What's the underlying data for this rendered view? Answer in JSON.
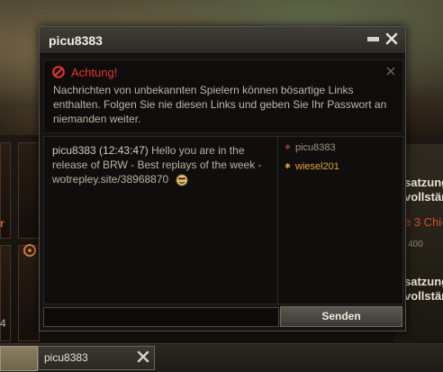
{
  "chat_window": {
    "title": "picu8383",
    "warning": {
      "title": "Achtung!",
      "text": "Nachrichten von unbekannten Spielern können bösartige Links enthalten. Folgen Sie nie diesen Links und geben Sie Ihr Passwort an niemanden weiter."
    },
    "message": {
      "sender": "picu8383 (12:43:47)",
      "text": "Hello you are in the release of BRW - Best replays of the week - wotrepley.site/38968870"
    },
    "participants": [
      {
        "name": "picu8383",
        "status_color": "#8a3a2c"
      },
      {
        "name": "wiesel201",
        "status_color": "#e7a233"
      }
    ],
    "input": {
      "value": ""
    },
    "send_label": "Senden"
  },
  "background": {
    "right_texts": [
      "satzung",
      "vollstän",
      "e 3 Chi-",
      "400",
      "satzung",
      "vollstän"
    ],
    "left_texts": [
      "r",
      "4"
    ]
  },
  "taskbar": {
    "tab_label": "picu8383"
  },
  "icons": [
    "minimize-icon",
    "close-icon",
    "warning-icon",
    "smiley-icon",
    "online-status-icon"
  ]
}
